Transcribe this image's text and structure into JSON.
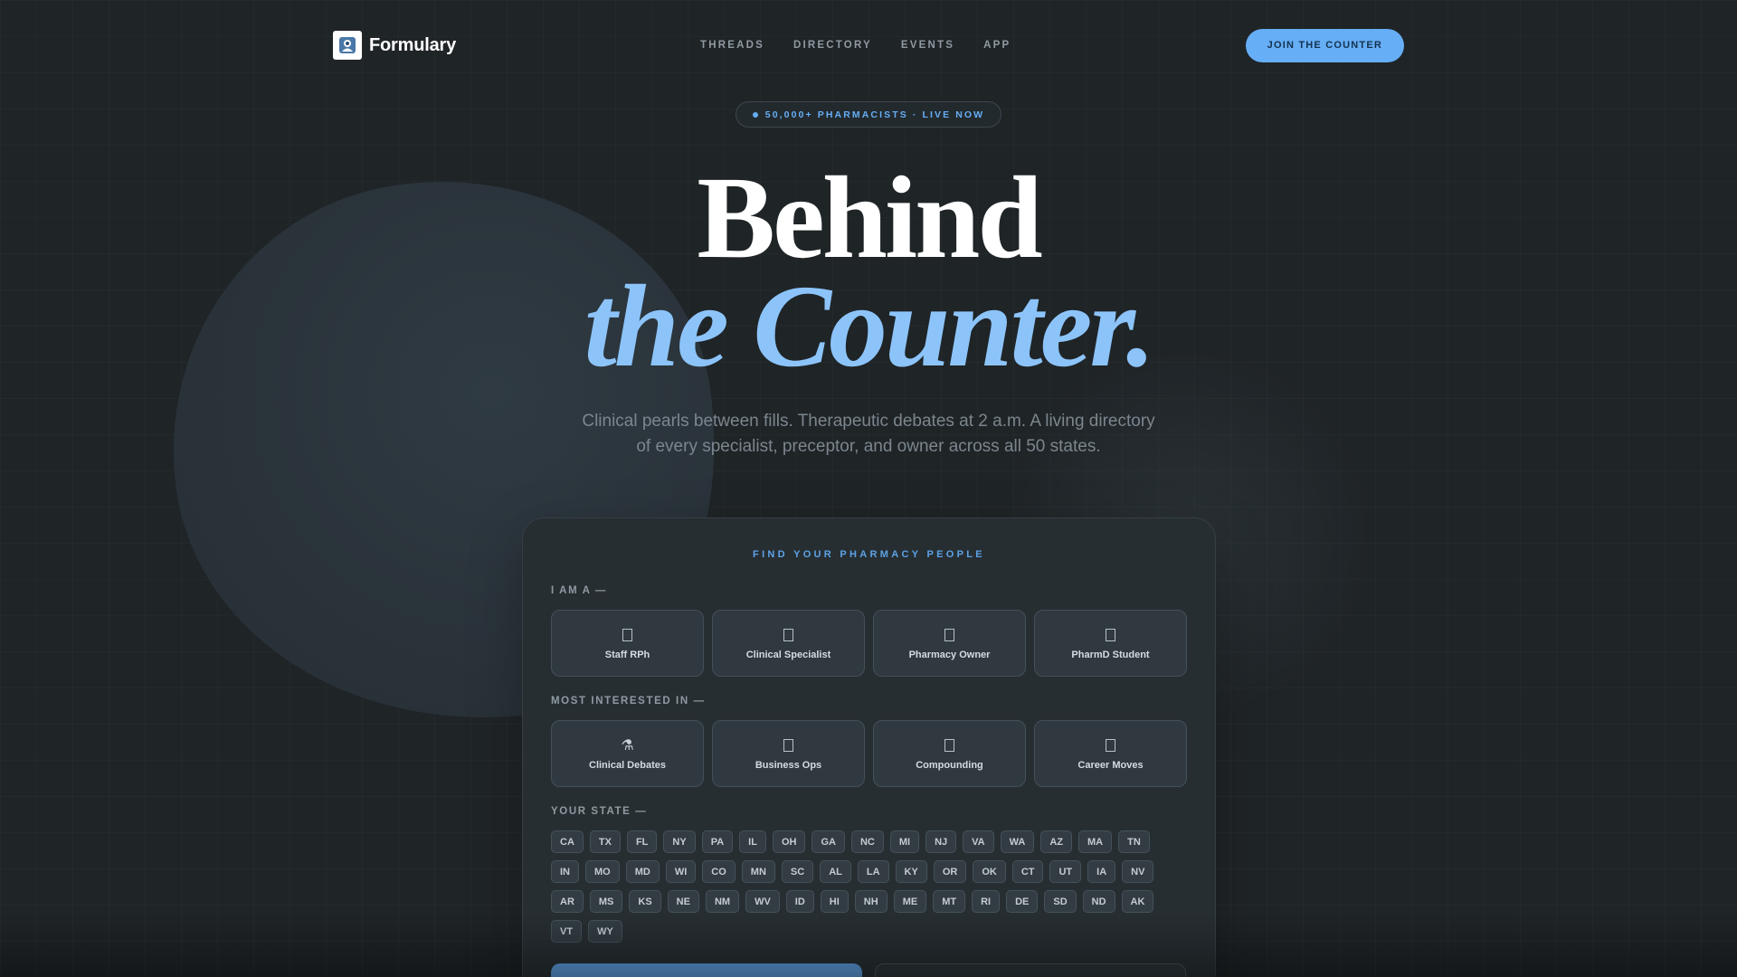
{
  "brand": {
    "name": "Formulary"
  },
  "nav": {
    "links": [
      "THREADS",
      "DIRECTORY",
      "EVENTS",
      "APP"
    ],
    "cta": "JOIN THE COUNTER"
  },
  "hero": {
    "pill": "50,000+ PHARMACISTS · LIVE NOW",
    "title_line1": "Behind",
    "title_line2": "the Counter.",
    "subtitle_line1": "Clinical pearls between fills. Therapeutic debates at 2 a.m. A living directory",
    "subtitle_line2": "of every specialist, preceptor, and owner across all 50 states."
  },
  "finder": {
    "kicker": "FIND YOUR PHARMACY PEOPLE",
    "role_label": "I AM A —",
    "roles": [
      {
        "label": "Staff RPh",
        "icon": "box-glyph-icon"
      },
      {
        "label": "Clinical Specialist",
        "icon": "box-glyph-icon"
      },
      {
        "label": "Pharmacy Owner",
        "icon": "box-glyph-icon"
      },
      {
        "label": "PharmD Student",
        "icon": "box-glyph-icon"
      }
    ],
    "interest_label": "MOST INTERESTED IN —",
    "interests": [
      {
        "label": "Clinical Debates",
        "icon": "flask-icon"
      },
      {
        "label": "Business Ops",
        "icon": "box-glyph-icon"
      },
      {
        "label": "Compounding",
        "icon": "box-glyph-icon"
      },
      {
        "label": "Career Moves",
        "icon": "box-glyph-icon"
      }
    ],
    "state_label": "YOUR STATE —",
    "states": [
      [
        "CA",
        "TX",
        "FL",
        "NY",
        "PA",
        "IL",
        "OH",
        "GA",
        "NC",
        "MI",
        "NJ",
        "VA",
        "WA",
        "AZ",
        "MA",
        "TN"
      ],
      [
        "IN",
        "MO",
        "MD",
        "WI",
        "CO",
        "MN",
        "SC",
        "AL",
        "LA",
        "KY",
        "OR",
        "OK",
        "CT",
        "UT",
        "IA",
        "NV"
      ],
      [
        "AR",
        "MS",
        "KS",
        "NE",
        "NM",
        "WV",
        "ID",
        "HI",
        "NH",
        "ME",
        "MT",
        "RI",
        "DE",
        "SD",
        "ND",
        "AK"
      ],
      [
        "VT",
        "WY"
      ]
    ]
  },
  "colors": {
    "accent": "#66aef5",
    "title_italic": "#8cc4fa",
    "background": "#1f2427",
    "card": "#272e32"
  }
}
